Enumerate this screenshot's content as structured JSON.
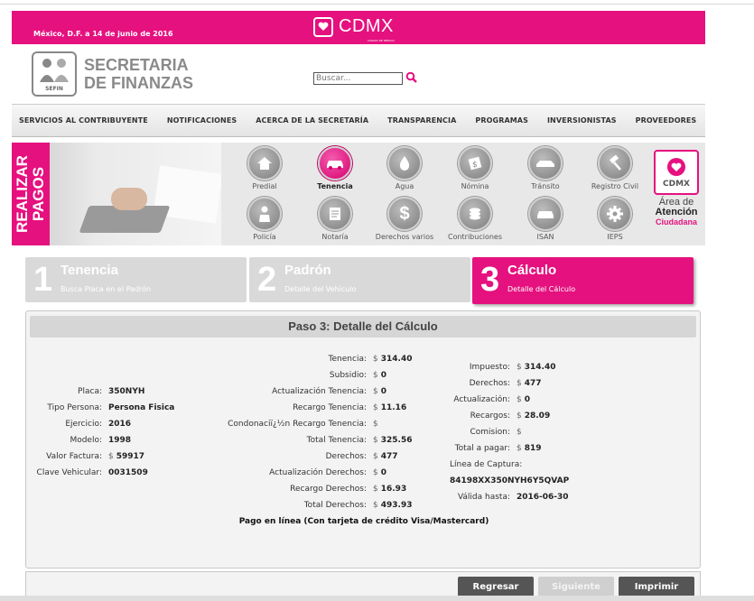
{
  "topbar": {
    "date": "México, D.F. a 14 de junio de 2016",
    "brand": "CDMX",
    "brand_sub": "CIUDAD DE MÉXICO",
    "color": "#e5117f"
  },
  "header": {
    "logo_label": "SEFIN",
    "title_line1": "SECRETARIA",
    "title_line2": "DE FINANZAS",
    "search_placeholder": "Buscar..."
  },
  "nav": {
    "items": [
      "SERVICIOS AL CONTRIBUYENTE",
      "NOTIFICACIONES",
      "ACERCA DE LA SECRETARÍA",
      "TRANSPARENCIA",
      "PROGRAMAS",
      "INVERSIONISTAS",
      "PROVEEDORES"
    ]
  },
  "payments": {
    "banner_line1": "REALIZAR",
    "banner_line2": "PAGOS",
    "items": [
      {
        "label": "Predial",
        "icon": "house-icon"
      },
      {
        "label": "Tenencia",
        "icon": "car-icon",
        "active": true
      },
      {
        "label": "Agua",
        "icon": "water-drop-icon"
      },
      {
        "label": "Nómina",
        "icon": "payroll-icon"
      },
      {
        "label": "Tránsito",
        "icon": "traffic-icon"
      },
      {
        "label": "Registro Civil",
        "icon": "gavel-icon"
      },
      {
        "label": "Policía",
        "icon": "police-icon"
      },
      {
        "label": "Notaría",
        "icon": "notary-icon"
      },
      {
        "label": "Derechos varios",
        "icon": "dollar-icon"
      },
      {
        "label": "Contribuciones",
        "icon": "coins-icon"
      },
      {
        "label": "ISAN",
        "icon": "new-car-icon"
      },
      {
        "label": "IEPS",
        "icon": "gear-icon"
      }
    ],
    "atencion": {
      "brand": "CDMX",
      "line1": "Área de",
      "line2": "Atención",
      "line3": "Ciudadana"
    }
  },
  "steps": [
    {
      "num": "1",
      "title": "Tenencia",
      "sub": "Busca Placa en el Padrón"
    },
    {
      "num": "2",
      "title": "Padrón",
      "sub": "Detalle del Vehículo"
    },
    {
      "num": "3",
      "title": "Cálculo",
      "sub": "Detalle del Cálculo",
      "active": true
    }
  ],
  "detail": {
    "heading": "Paso 3: Detalle del Cálculo",
    "vehicle": [
      {
        "label": "Placa:",
        "value": "350NYH"
      },
      {
        "label": "Tipo Persona:",
        "value": "Persona Fisica"
      },
      {
        "label": "Ejercicio:",
        "value": "2016"
      },
      {
        "label": "Modelo:",
        "value": "1998"
      },
      {
        "label": "Valor Factura:",
        "currency": "$",
        "value": "59917"
      },
      {
        "label": "Clave Vehicular:",
        "value": "0031509"
      }
    ],
    "calc": [
      {
        "label": "Tenencia:",
        "currency": "$",
        "value": "314.40"
      },
      {
        "label": "Subsidio:",
        "currency": "$",
        "value": "0"
      },
      {
        "label": "Actualización Tenencia:",
        "currency": "$",
        "value": "0"
      },
      {
        "label": "Recargo Tenencia:",
        "currency": "$",
        "value": "11.16"
      },
      {
        "label": "Condonaciï¿½n Recargo Tenencia:",
        "currency": "$",
        "value": ""
      },
      {
        "label": "Total Tenencia:",
        "currency": "$",
        "value": "325.56"
      },
      {
        "label": "Derechos:",
        "currency": "$",
        "value": "477"
      },
      {
        "label": "Actualización Derechos:",
        "currency": "$",
        "value": "0"
      },
      {
        "label": "Recargo Derechos:",
        "currency": "$",
        "value": "16.93"
      },
      {
        "label": "Total Derechos:",
        "currency": "$",
        "value": "493.93"
      }
    ],
    "summary": [
      {
        "label": "Impuesto:",
        "currency": "$",
        "value": "314.40"
      },
      {
        "label": "Derechos:",
        "currency": "$",
        "value": "477"
      },
      {
        "label": "Actualización:",
        "currency": "$",
        "value": "0"
      },
      {
        "label": "Recargos:",
        "currency": "$",
        "value": "28.09"
      },
      {
        "label": "Comision:",
        "currency": "$",
        "value": ""
      },
      {
        "label": "Total a pagar:",
        "currency": "$",
        "value": "819"
      }
    ],
    "capture_label": "Línea de Captura:",
    "capture_value": "84198XX350NYH6Y5QVAP",
    "valid_label": "Válida hasta:",
    "valid_value": "2016-06-30",
    "pay_online": "Pago en línea (Con tarjeta de crédito Visa/Mastercard)"
  },
  "buttons": {
    "back": "Regresar",
    "next": "Siguiente",
    "print": "Imprimir"
  }
}
